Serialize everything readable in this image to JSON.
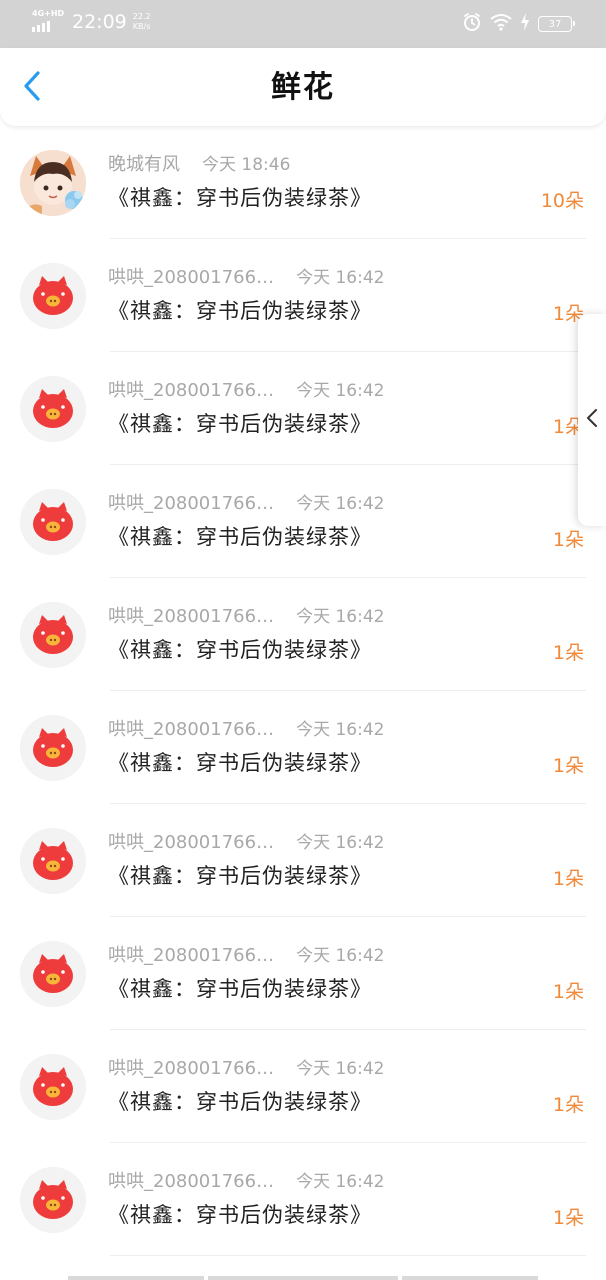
{
  "status_bar": {
    "network": "4G+HD",
    "time": "22:09",
    "speed_value": "22.2",
    "speed_unit": "KB/s",
    "battery": "37",
    "icons": [
      "signal-icon",
      "alarm-icon",
      "wifi-icon",
      "charging-icon",
      "battery-icon"
    ]
  },
  "header": {
    "back_icon": "chevron-left-icon",
    "title": "鲜花"
  },
  "items": [
    {
      "name": "晚城有风",
      "time": "今天 18:46",
      "book": "《祺鑫：穿书后伪装绿茶》",
      "count": "10朵",
      "avatar": "user-avatar"
    },
    {
      "name": "哄哄_208001766…",
      "time": "今天 16:42",
      "book": "《祺鑫：穿书后伪装绿茶》",
      "count": "1朵",
      "avatar": "pig-avatar"
    },
    {
      "name": "哄哄_208001766…",
      "time": "今天 16:42",
      "book": "《祺鑫：穿书后伪装绿茶》",
      "count": "1朵",
      "avatar": "pig-avatar"
    },
    {
      "name": "哄哄_208001766…",
      "time": "今天 16:42",
      "book": "《祺鑫：穿书后伪装绿茶》",
      "count": "1朵",
      "avatar": "pig-avatar"
    },
    {
      "name": "哄哄_208001766…",
      "time": "今天 16:42",
      "book": "《祺鑫：穿书后伪装绿茶》",
      "count": "1朵",
      "avatar": "pig-avatar"
    },
    {
      "name": "哄哄_208001766…",
      "time": "今天 16:42",
      "book": "《祺鑫：穿书后伪装绿茶》",
      "count": "1朵",
      "avatar": "pig-avatar"
    },
    {
      "name": "哄哄_208001766…",
      "time": "今天 16:42",
      "book": "《祺鑫：穿书后伪装绿茶》",
      "count": "1朵",
      "avatar": "pig-avatar"
    },
    {
      "name": "哄哄_208001766…",
      "time": "今天 16:42",
      "book": "《祺鑫：穿书后伪装绿茶》",
      "count": "1朵",
      "avatar": "pig-avatar"
    },
    {
      "name": "哄哄_208001766…",
      "time": "今天 16:42",
      "book": "《祺鑫：穿书后伪装绿茶》",
      "count": "1朵",
      "avatar": "pig-avatar"
    },
    {
      "name": "哄哄_208001766…",
      "time": "今天 16:42",
      "book": "《祺鑫：穿书后伪装绿茶》",
      "count": "1朵",
      "avatar": "pig-avatar"
    }
  ],
  "side_handle": {
    "icon": "chevron-left-icon"
  },
  "colors": {
    "accent_blue": "#2a9bef",
    "count_orange": "#f0893a",
    "muted_text": "#a8a8a8",
    "status_bar": "#d3d3d3",
    "pig_red": "#ee3b3b"
  }
}
